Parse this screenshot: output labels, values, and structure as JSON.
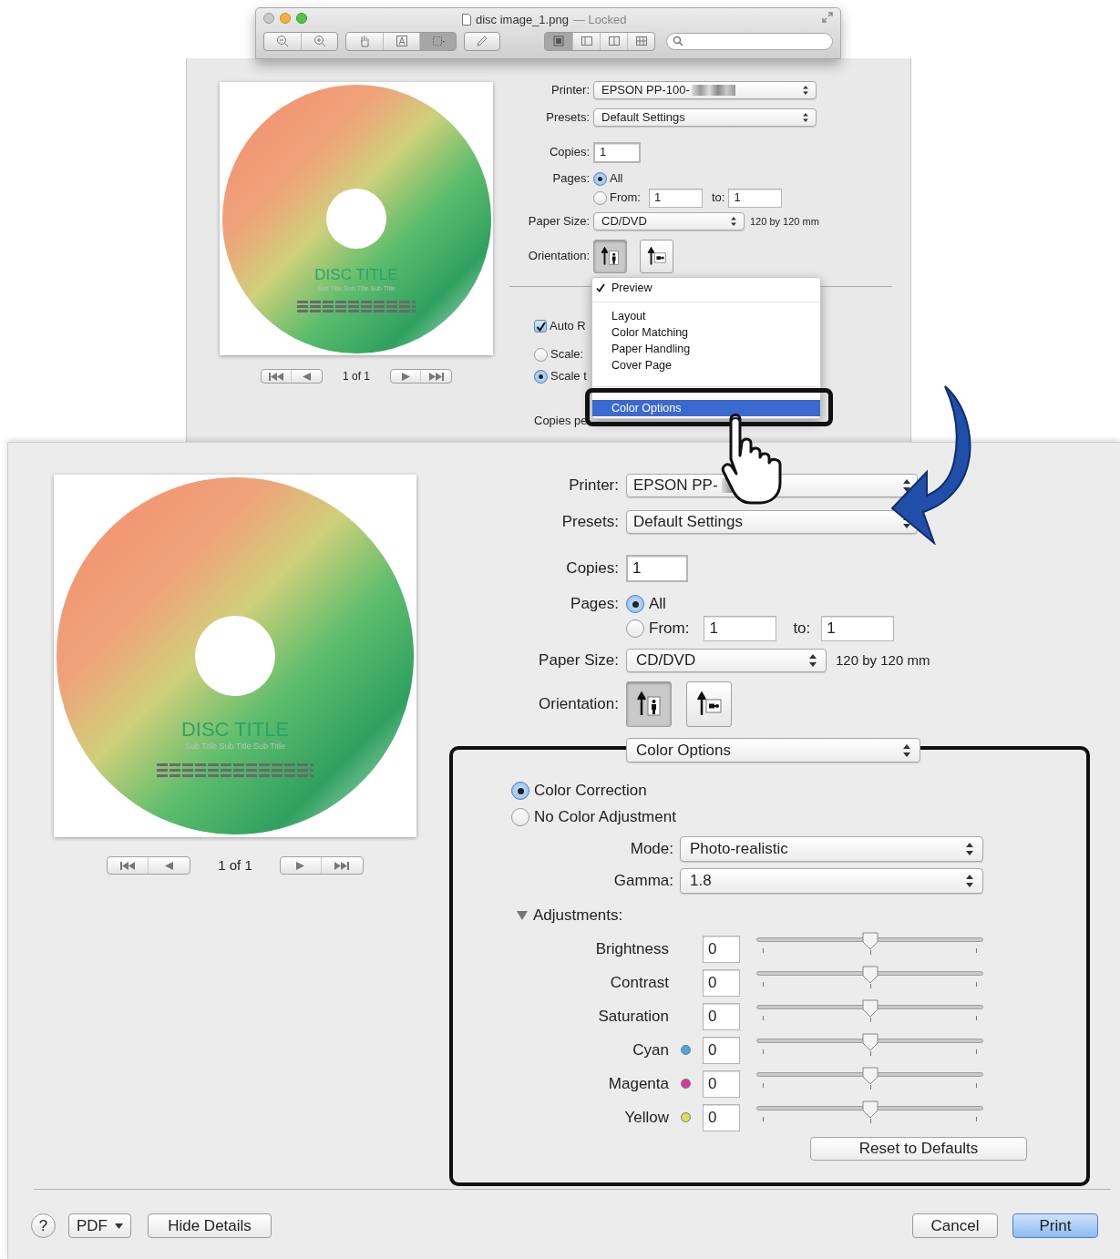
{
  "preview_window": {
    "title": "disc image_1.png",
    "status": "— Locked"
  },
  "top_dialog": {
    "preview": {
      "title": "DISC TITLE",
      "subtitle": "Sub Title Sub Title Sub Title",
      "page": "1 of 1"
    },
    "printer": {
      "label": "Printer:",
      "value": "EPSON PP-100-"
    },
    "presets": {
      "label": "Presets:",
      "value": "Default Settings"
    },
    "copies": {
      "label": "Copies:",
      "value": "1"
    },
    "pages": {
      "label": "Pages:",
      "all": {
        "label": "All",
        "selected": true
      },
      "from": {
        "label": "From:",
        "selected": false,
        "value": "1"
      },
      "to_label": "to:",
      "to": "1"
    },
    "paper_size": {
      "label": "Paper Size:",
      "value": "CD/DVD",
      "dimensions": "120 by 120 mm"
    },
    "orientation": {
      "label": "Orientation:",
      "options": [
        {
          "kind": "portrait",
          "selected": true
        },
        {
          "kind": "landscape",
          "selected": false
        }
      ]
    },
    "auto_rotate": {
      "label": "Auto R",
      "checked": true
    },
    "scale_options": [
      {
        "label": "Scale:",
        "selected": false
      },
      {
        "label": "Scale t",
        "selected": true
      }
    ],
    "copies_per_page": "Copies pe",
    "menu": {
      "groups": [
        [
          {
            "label": "Preview",
            "checked": true,
            "selected": false
          }
        ],
        [
          {
            "label": "Layout",
            "checked": false,
            "selected": false
          },
          {
            "label": "Color Matching",
            "checked": false,
            "selected": false
          },
          {
            "label": "Paper Handling",
            "checked": false,
            "selected": false
          },
          {
            "label": "Cover Page",
            "checked": false,
            "selected": false
          }
        ],
        [
          {
            "label": "Color Options",
            "checked": false,
            "selected": true
          }
        ]
      ]
    }
  },
  "bottom_dialog": {
    "preview": {
      "title": "DISC TITLE",
      "subtitle": "Sub Title Sub Title Sub Title",
      "page": "1 of 1"
    },
    "printer": {
      "label": "Printer:",
      "value": "EPSON PP-"
    },
    "presets": {
      "label": "Presets:",
      "value": "Default Settings"
    },
    "copies": {
      "label": "Copies:",
      "value": "1"
    },
    "pages": {
      "label": "Pages:",
      "all": {
        "label": "All",
        "selected": true
      },
      "from": {
        "label": "From:",
        "selected": false,
        "value": "1"
      },
      "to_label": "to:",
      "to": "1"
    },
    "paper_size": {
      "label": "Paper Size:",
      "value": "CD/DVD",
      "dimensions": "120 by 120 mm"
    },
    "orientation": {
      "label": "Orientation:",
      "options": [
        {
          "kind": "portrait",
          "selected": true
        },
        {
          "kind": "landscape",
          "selected": false
        }
      ]
    },
    "panel": "Color Options",
    "color_modes": [
      {
        "label": "Color Correction",
        "selected": true
      },
      {
        "label": "No Color Adjustment",
        "selected": false
      }
    ],
    "mode": {
      "label": "Mode:",
      "value": "Photo-realistic"
    },
    "gamma": {
      "label": "Gamma:",
      "value": "1.8"
    },
    "adjustments": {
      "label": "Adjustments:",
      "expanded": true,
      "rows": [
        {
          "label": "Brightness",
          "value": "0",
          "level": 0.5
        },
        {
          "label": "Contrast",
          "value": "0",
          "level": 0.5
        },
        {
          "label": "Saturation",
          "value": "0",
          "level": 0.5
        },
        {
          "label": "Cyan",
          "value": "0",
          "level": 0.5,
          "color": "#4aa8e0"
        },
        {
          "label": "Magenta",
          "value": "0",
          "level": 0.5,
          "color": "#d63a9e"
        },
        {
          "label": "Yellow",
          "value": "0",
          "level": 0.5,
          "color": "#d8e05a"
        }
      ]
    },
    "reset": "Reset to Defaults",
    "footer": {
      "help": "?",
      "pdf": "PDF",
      "hide_details": "Hide Details",
      "buttons": [
        {
          "label": "Cancel",
          "default": false
        },
        {
          "label": "Print",
          "default": true
        }
      ]
    }
  }
}
